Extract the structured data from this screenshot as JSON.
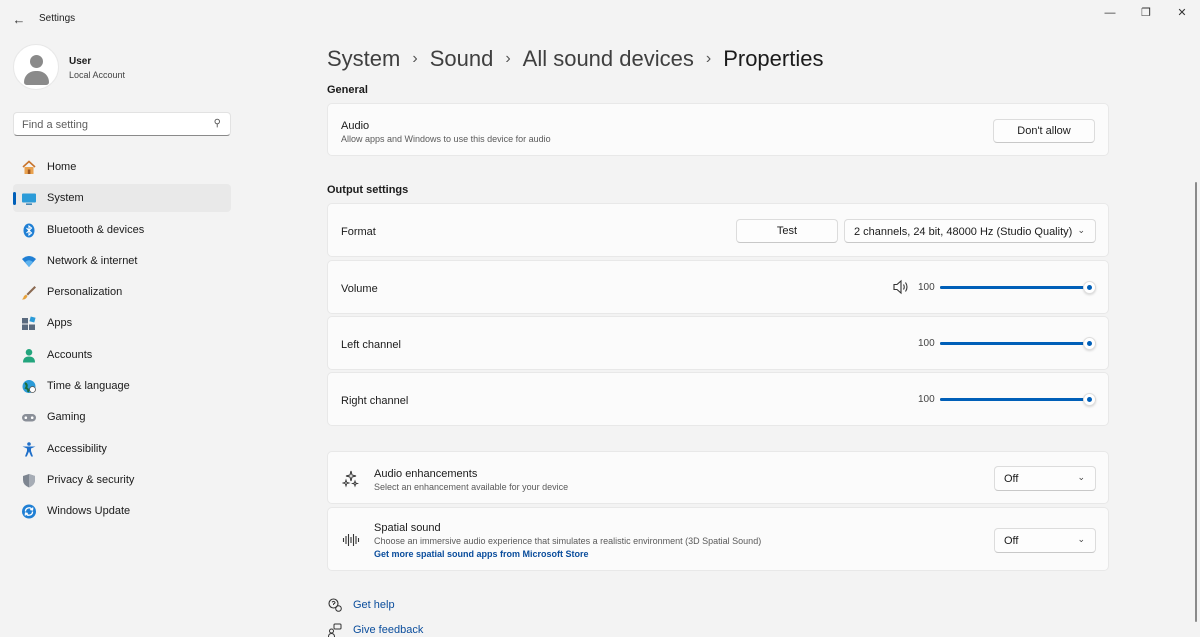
{
  "window": {
    "title": "Settings"
  },
  "user": {
    "name": "User",
    "account_type": "Local Account"
  },
  "search": {
    "placeholder": "Find a setting"
  },
  "nav": {
    "items": [
      {
        "label": "Home",
        "icon": "home-icon",
        "active": false
      },
      {
        "label": "System",
        "icon": "system-icon",
        "active": true
      },
      {
        "label": "Bluetooth & devices",
        "icon": "bluetooth-icon",
        "active": false
      },
      {
        "label": "Network & internet",
        "icon": "wifi-icon",
        "active": false
      },
      {
        "label": "Personalization",
        "icon": "brush-icon",
        "active": false
      },
      {
        "label": "Apps",
        "icon": "apps-icon",
        "active": false
      },
      {
        "label": "Accounts",
        "icon": "accounts-icon",
        "active": false
      },
      {
        "label": "Time & language",
        "icon": "globe-icon",
        "active": false
      },
      {
        "label": "Gaming",
        "icon": "gamepad-icon",
        "active": false
      },
      {
        "label": "Accessibility",
        "icon": "accessibility-icon",
        "active": false
      },
      {
        "label": "Privacy & security",
        "icon": "shield-icon",
        "active": false
      },
      {
        "label": "Windows Update",
        "icon": "update-icon",
        "active": false
      }
    ]
  },
  "breadcrumb": {
    "items": [
      "System",
      "Sound",
      "All sound devices"
    ],
    "current": "Properties"
  },
  "general": {
    "title": "General",
    "audio": {
      "title": "Audio",
      "subtitle": "Allow apps and Windows to use this device for audio",
      "button": "Don't allow"
    }
  },
  "output": {
    "title": "Output settings",
    "format": {
      "title": "Format",
      "test_button": "Test",
      "selected": "2 channels, 24 bit, 48000 Hz (Studio Quality)"
    },
    "volume": {
      "title": "Volume",
      "value": "100",
      "level": 1.0
    },
    "left": {
      "title": "Left channel",
      "value": "100",
      "level": 1.0
    },
    "right": {
      "title": "Right channel",
      "value": "100",
      "level": 1.0
    }
  },
  "enhancements": {
    "title": "Audio enhancements",
    "subtitle": "Select an enhancement available for your device",
    "selected": "Off"
  },
  "spatial": {
    "title": "Spatial sound",
    "subtitle": "Choose an immersive audio experience that simulates a realistic environment (3D Spatial Sound)",
    "link": "Get more spatial sound apps from Microsoft Store",
    "selected": "Off"
  },
  "footer": {
    "help": "Get help",
    "feedback": "Give feedback"
  },
  "colors": {
    "accent": "#005fb8",
    "background": "#f3f3f3",
    "card": "#fbfbfb"
  }
}
